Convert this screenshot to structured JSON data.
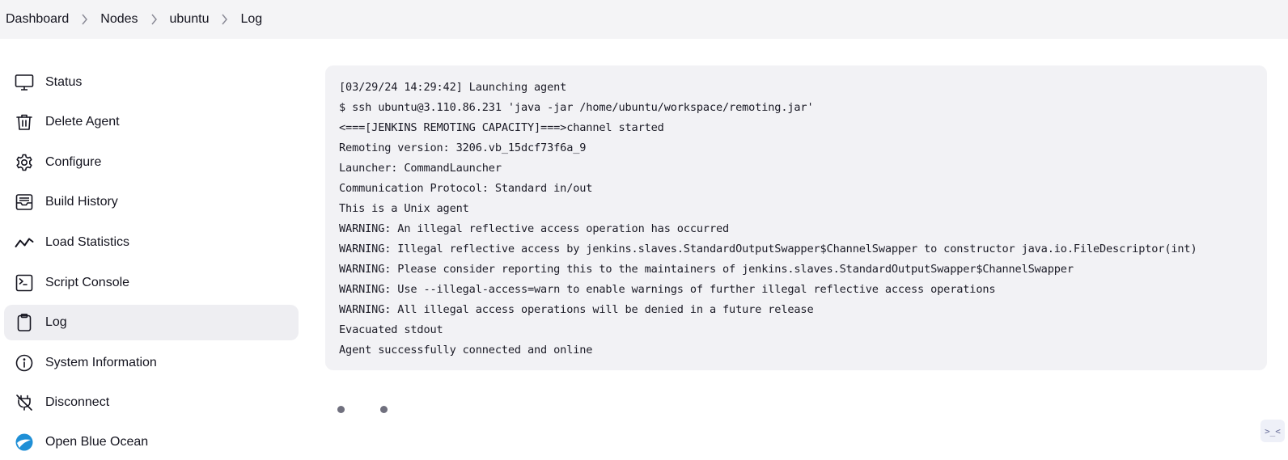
{
  "breadcrumb": {
    "items": [
      {
        "label": "Dashboard"
      },
      {
        "label": "Nodes"
      },
      {
        "label": "ubuntu"
      },
      {
        "label": "Log"
      }
    ]
  },
  "sidebar": {
    "items": [
      {
        "label": "Status",
        "icon": "monitor-icon"
      },
      {
        "label": "Delete Agent",
        "icon": "trash-icon"
      },
      {
        "label": "Configure",
        "icon": "gear-icon"
      },
      {
        "label": "Build History",
        "icon": "inbox-icon"
      },
      {
        "label": "Load Statistics",
        "icon": "trend-icon"
      },
      {
        "label": "Script Console",
        "icon": "terminal-icon"
      },
      {
        "label": "Log",
        "icon": "clipboard-icon",
        "active": true
      },
      {
        "label": "System Information",
        "icon": "info-icon"
      },
      {
        "label": "Disconnect",
        "icon": "disconnect-plug-icon"
      },
      {
        "label": "Open Blue Ocean",
        "icon": "blue-ocean-icon"
      }
    ]
  },
  "console": {
    "lines": [
      "[03/29/24 14:29:42] Launching agent",
      "$ ssh ubuntu@3.110.86.231 'java -jar /home/ubuntu/workspace/remoting.jar'",
      "<===[JENKINS REMOTING CAPACITY]===>channel started",
      "Remoting version: 3206.vb_15dcf73f6a_9",
      "Launcher: CommandLauncher",
      "Communication Protocol: Standard in/out",
      "This is a Unix agent",
      "WARNING: An illegal reflective access operation has occurred",
      "WARNING: Illegal reflective access by jenkins.slaves.StandardOutputSwapper$ChannelSwapper to constructor java.io.FileDescriptor(int)",
      "WARNING: Please consider reporting this to the maintainers of jenkins.slaves.StandardOutputSwapper$ChannelSwapper",
      "WARNING: Use --illegal-access=warn to enable warnings of further illegal reflective access operations",
      "WARNING: All illegal access operations will be denied in a future release",
      "Evacuated stdout",
      "Agent successfully connected and online"
    ]
  },
  "corner_button": {
    "label": ">_<"
  }
}
